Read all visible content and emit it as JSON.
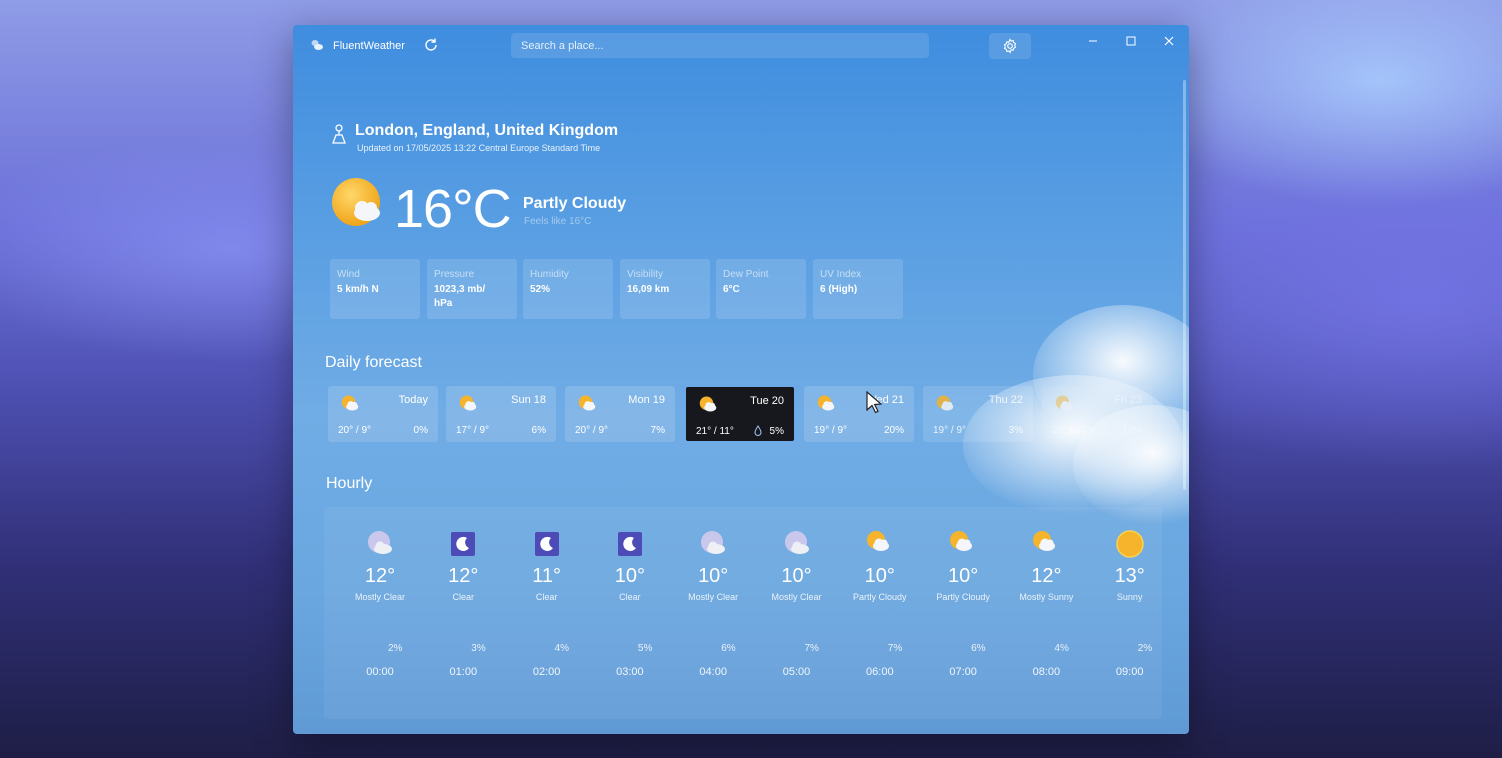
{
  "app": {
    "name": "FluentWeather"
  },
  "search": {
    "placeholder": "Search a place..."
  },
  "location": {
    "name": "London, England, United Kingdom",
    "updated": "Updated on 17/05/2025 13:22 Central Europe Standard Time"
  },
  "current": {
    "temp": "16°C",
    "condition": "Partly Cloudy",
    "feels_like": "Feels like 16°C",
    "icon": "sun-cloud-icon"
  },
  "metrics": [
    {
      "label": "Wind",
      "value": "5 km/h N"
    },
    {
      "label": "Pressure",
      "value": "1023,3 mb/ hPa"
    },
    {
      "label": "Humidity",
      "value": "52%"
    },
    {
      "label": "Visibility",
      "value": "16,09 km"
    },
    {
      "label": "Dew Point",
      "value": "6°C"
    },
    {
      "label": "UV Index",
      "value": "6 (High)"
    }
  ],
  "daily": {
    "title": "Daily forecast",
    "days": [
      {
        "name": "Today",
        "temps": "20° / 9°",
        "precip": "0%",
        "icon": "sun-cloud-icon"
      },
      {
        "name": "Sun 18",
        "temps": "17° / 9°",
        "precip": "6%",
        "icon": "sun-cloud-icon"
      },
      {
        "name": "Mon 19",
        "temps": "20° / 9°",
        "precip": "7%",
        "icon": "sun-cloud-icon"
      },
      {
        "name": "Tue 20",
        "temps": "21° / 11°",
        "precip": "5%",
        "icon": "sun-cloud-icon",
        "selected": true
      },
      {
        "name": "Wed 21",
        "temps": "19° / 9°",
        "precip": "20%",
        "icon": "sun-cloud-icon"
      },
      {
        "name": "Thu 22",
        "temps": "19° / 9°",
        "precip": "3%",
        "icon": "sun-cloud-icon"
      },
      {
        "name": "Fri 23",
        "temps": "20° / 13°",
        "precip": "12%",
        "icon": "sun-cloud-icon"
      }
    ]
  },
  "hourly": {
    "title": "Hourly",
    "hours": [
      {
        "time": "00:00",
        "temp": "12°",
        "condition": "Mostly Clear",
        "precip": "2%",
        "icon": "moon-cloud-icon"
      },
      {
        "time": "01:00",
        "temp": "12°",
        "condition": "Clear",
        "precip": "3%",
        "icon": "moon-icon"
      },
      {
        "time": "02:00",
        "temp": "11°",
        "condition": "Clear",
        "precip": "4%",
        "icon": "moon-icon"
      },
      {
        "time": "03:00",
        "temp": "10°",
        "condition": "Clear",
        "precip": "5%",
        "icon": "moon-icon"
      },
      {
        "time": "04:00",
        "temp": "10°",
        "condition": "Mostly Clear",
        "precip": "6%",
        "icon": "moon-cloud-icon"
      },
      {
        "time": "05:00",
        "temp": "10°",
        "condition": "Mostly Clear",
        "precip": "7%",
        "icon": "moon-cloud-icon"
      },
      {
        "time": "06:00",
        "temp": "10°",
        "condition": "Partly Cloudy",
        "precip": "7%",
        "icon": "sun-cloud-icon"
      },
      {
        "time": "07:00",
        "temp": "10°",
        "condition": "Partly Cloudy",
        "precip": "6%",
        "icon": "sun-cloud-icon"
      },
      {
        "time": "08:00",
        "temp": "12°",
        "condition": "Mostly Sunny",
        "precip": "4%",
        "icon": "sun-cloud-icon"
      },
      {
        "time": "09:00",
        "temp": "13°",
        "condition": "Sunny",
        "precip": "2%",
        "icon": "sun-icon"
      }
    ]
  },
  "colors": {
    "accent": "#4a93df",
    "selected_card": "#16181d",
    "sun": "#f5b42c"
  }
}
